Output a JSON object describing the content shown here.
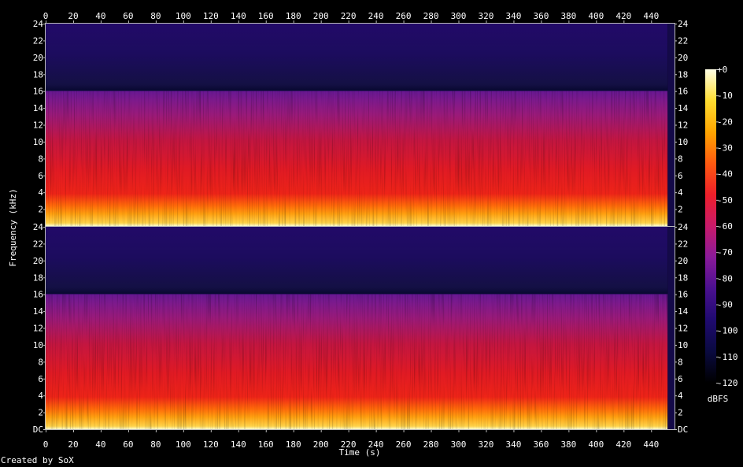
{
  "footer": "Created by SoX",
  "chart_data": {
    "type": "heatmap",
    "title": "",
    "xlabel": "Time (s)",
    "ylabel": "Frequency (kHz)",
    "xlim": [
      0,
      457
    ],
    "x_ticks": [
      0,
      20,
      40,
      60,
      80,
      100,
      120,
      140,
      160,
      180,
      200,
      220,
      240,
      260,
      280,
      300,
      320,
      340,
      360,
      380,
      400,
      420,
      440
    ],
    "ylim": [
      0,
      24
    ],
    "channels": [
      {
        "y_ticks": [
          "24",
          "22",
          "20",
          "18",
          "16",
          "14",
          "12",
          "10",
          "8",
          "6",
          "4",
          "2"
        ],
        "spectral_cutoff_khz": 16,
        "content_end_s": 452
      },
      {
        "y_ticks": [
          "24",
          "22",
          "20",
          "18",
          "16",
          "14",
          "12",
          "10",
          "8",
          "6",
          "4",
          "2",
          "DC"
        ],
        "spectral_cutoff_khz": 16,
        "content_end_s": 452
      }
    ],
    "colorbar": {
      "label": "dBFS",
      "ticks": [
        "+0",
        "-10",
        "-20",
        "-30",
        "-40",
        "-50",
        "-60",
        "-70",
        "-80",
        "-90",
        "-100",
        "-110",
        "-120"
      ],
      "range": [
        -120,
        0
      ],
      "colors": [
        "#000000",
        "#0a0a40",
        "#1f0a70",
        "#4a1090",
        "#8a1a9a",
        "#c81a6a",
        "#ee1f2a",
        "#ff5a10",
        "#ffa500",
        "#ffdd30",
        "#ffffe6"
      ]
    },
    "grid": false,
    "legend": "colorbar-right"
  }
}
